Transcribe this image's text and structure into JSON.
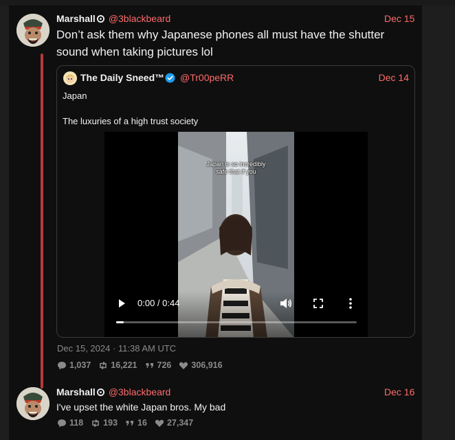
{
  "tweet1": {
    "display_name": "Marshall",
    "handle": "@3blackbeard",
    "date": "Dec 15",
    "text_line1": "Don’t ask them why Japanese phones all must have the shutter",
    "text_line2": "sound when taking pictures lol",
    "timestamp": "Dec 15, 2024 · 11:38 AM UTC",
    "stats": {
      "replies": "1,037",
      "retweets": "16,221",
      "quotes": "726",
      "likes": "306,916"
    }
  },
  "quote": {
    "display_name": "The Daily Sneed™",
    "handle": "@Tr00peRR",
    "date": "Dec 14",
    "text_line1": "Japan",
    "text_line2": "The luxuries of a high trust society",
    "video": {
      "caption_line1": "Japan is so incredibly",
      "caption_line2": "safe that if you",
      "time": "0:00 / 0:44",
      "progress": 0.03
    }
  },
  "tweet2": {
    "display_name": "Marshall",
    "handle": "@3blackbeard",
    "date": "Dec 16",
    "text": "I've upset the white Japan bros. My bad",
    "stats": {
      "replies": "118",
      "retweets": "193",
      "quotes": "16",
      "likes": "27,347"
    }
  },
  "colors": {
    "accent": "#ff6b6b",
    "thread_line": "#b33a3a",
    "muted": "#8a8a8a",
    "background": "#0f0f0f"
  },
  "icons": [
    "badge-icon",
    "verified-icon",
    "play-icon",
    "volume-icon",
    "fullscreen-icon",
    "more-vertical-icon",
    "reply-icon",
    "retweet-icon",
    "quote-icon",
    "like-icon"
  ]
}
